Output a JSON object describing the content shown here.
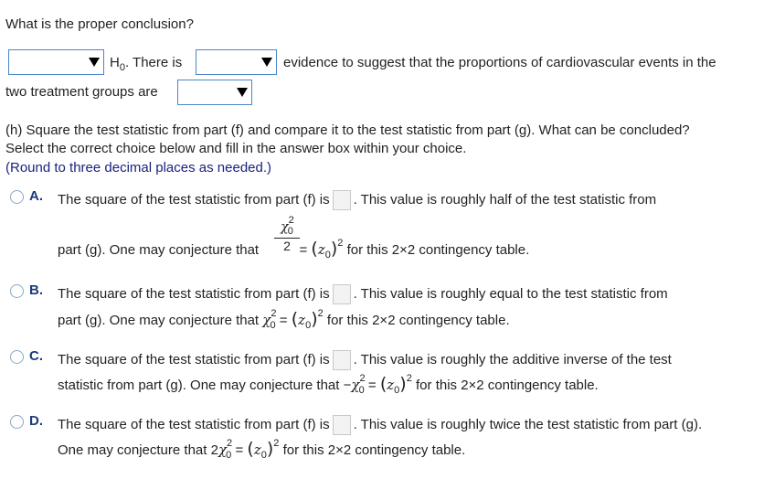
{
  "question_title": "What is the proper conclusion?",
  "conclusion": {
    "h0_text": "H",
    "h0_sub": "0",
    "h0_suffix": ". There is",
    "mid_text": "evidence to suggest that the proportions of cardiovascular events in the",
    "line2_text": "two treatment groups are"
  },
  "part_h": {
    "line1": "(h) Square the test statistic from part (f) and compare it to the test statistic from part (g). What can be concluded?",
    "line2": "Select the correct choice below and fill in the answer box within your choice.",
    "note": "(Round to three decimal places as needed.)"
  },
  "options": [
    {
      "letter": "A.",
      "line1_pre": "The square of the test statistic from part (f) is",
      "line1_post": ". This value is roughly half of the test statistic from",
      "line2_pre": "part (g). One may conjecture that",
      "line2_post": "for this 2×2 contingency table."
    },
    {
      "letter": "B.",
      "line1_pre": "The square of the test statistic from part (f) is",
      "line1_post": ". This value is roughly equal to the test statistic from",
      "line2_pre": "part (g). One may conjecture that",
      "line2_post": "for this 2×2 contingency table."
    },
    {
      "letter": "C.",
      "line1_pre": "The square of the test statistic from part (f) is",
      "line1_post": ". This value is roughly the additive inverse of the test",
      "line2_pre": "statistic from part (g). One may conjecture that",
      "line2_post": "for this 2×2 contingency table."
    },
    {
      "letter": "D.",
      "line1_pre": "The square of the test statistic from part (f) is",
      "line1_post": ". This value is roughly twice the test statistic from part (g).",
      "line2_pre": "One may conjecture that 2",
      "line2_post": "for this 2×2 contingency table."
    }
  ],
  "math": {
    "chi": "χ",
    "sq": "2",
    "sub0": "0",
    "equals": "=",
    "z0": "z",
    "lparen": "(",
    "rparen": ")",
    "minus": "−",
    "denominator": "2"
  },
  "colors": {
    "accent": "#4a86c8",
    "note": "#1a237e"
  }
}
